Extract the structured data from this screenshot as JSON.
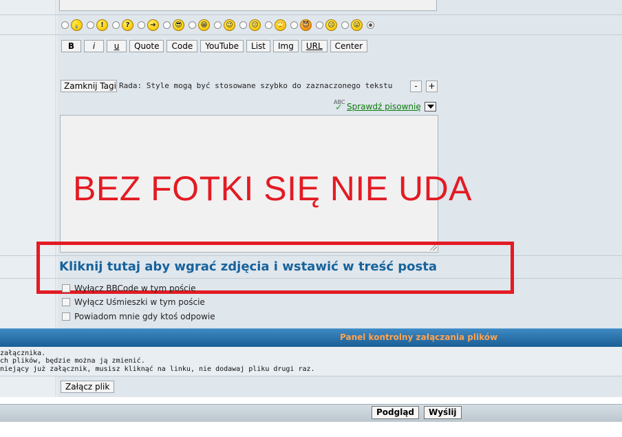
{
  "smilies": {
    "items": [
      {
        "icon": "lightbulb-smiley-icon",
        "glyph": "💡",
        "selected": false
      },
      {
        "icon": "exclamation-smiley-icon",
        "glyph": "!",
        "selected": false
      },
      {
        "icon": "question-smiley-icon",
        "glyph": "?",
        "selected": false
      },
      {
        "icon": "arrow-smiley-icon",
        "glyph": "➔",
        "selected": false
      },
      {
        "icon": "cool-smiley-icon",
        "glyph": "😎",
        "selected": false
      },
      {
        "icon": "grin-smiley-icon",
        "glyph": "😁",
        "selected": false
      },
      {
        "icon": "wink-smiley-icon",
        "glyph": "😉",
        "selected": false
      },
      {
        "icon": "neutral-smiley-icon",
        "glyph": "😐",
        "selected": false
      },
      {
        "icon": "rolleyes-smiley-icon",
        "glyph": "🙄",
        "selected": false
      },
      {
        "icon": "evil-smiley-icon",
        "glyph": "😈",
        "selected": false
      },
      {
        "icon": "sad-smiley-icon",
        "glyph": "☹",
        "selected": false
      },
      {
        "icon": "tongue-smiley-icon",
        "glyph": "😛",
        "selected": false
      }
    ],
    "none_selected": true
  },
  "toolbar": {
    "buttons": [
      {
        "key": "b",
        "label": "B"
      },
      {
        "key": "i",
        "label": "i"
      },
      {
        "key": "u",
        "label": "u"
      },
      {
        "key": "quote",
        "label": "Quote"
      },
      {
        "key": "code",
        "label": "Code"
      },
      {
        "key": "youtube",
        "label": "YouTube"
      },
      {
        "key": "list",
        "label": "List"
      },
      {
        "key": "img",
        "label": "Img"
      },
      {
        "key": "url",
        "label": "URL"
      },
      {
        "key": "center",
        "label": "Center"
      }
    ],
    "close_tags_label": "Zamknij Tagi",
    "hint": "Rada: Style mogą być stosowane szybko do zaznaczonego tekstu",
    "minus_label": "-",
    "plus_label": "+"
  },
  "spellcheck": {
    "icon_text": "ABC",
    "link_label": "Sprawdź pisownię"
  },
  "editor": {
    "overlay_text": "BEZ FOTKI SIĘ NIE UDA"
  },
  "upload": {
    "link_label": "Kliknij tutaj aby wgrać zdjęcia i wstawić w treść posta"
  },
  "options": [
    {
      "label": "Wyłącz BBCode w tym poście",
      "checked": false
    },
    {
      "label": "Wyłącz Uśmieszki w tym poście",
      "checked": false
    },
    {
      "label": "Powiadom mnie gdy ktoś odpowie",
      "checked": false
    }
  ],
  "attachments": {
    "panel_title": "Panel kontrolny załączania plików",
    "lines": [
      "załącznika.",
      "ch plików, będzie można ją zmienić.",
      "niejący już załącznik, musisz kliknąć na linku, nie dodawaj pliku drugi raz."
    ],
    "attach_button": "Załącz plik"
  },
  "footer": {
    "preview_label": "Podgląd",
    "submit_label": "Wyślij"
  },
  "colors": {
    "annotation_red": "#e31b23",
    "link_blue": "#17629b",
    "panel_title_orange": "#ffa34f",
    "spell_green": "#0a7a0a"
  }
}
